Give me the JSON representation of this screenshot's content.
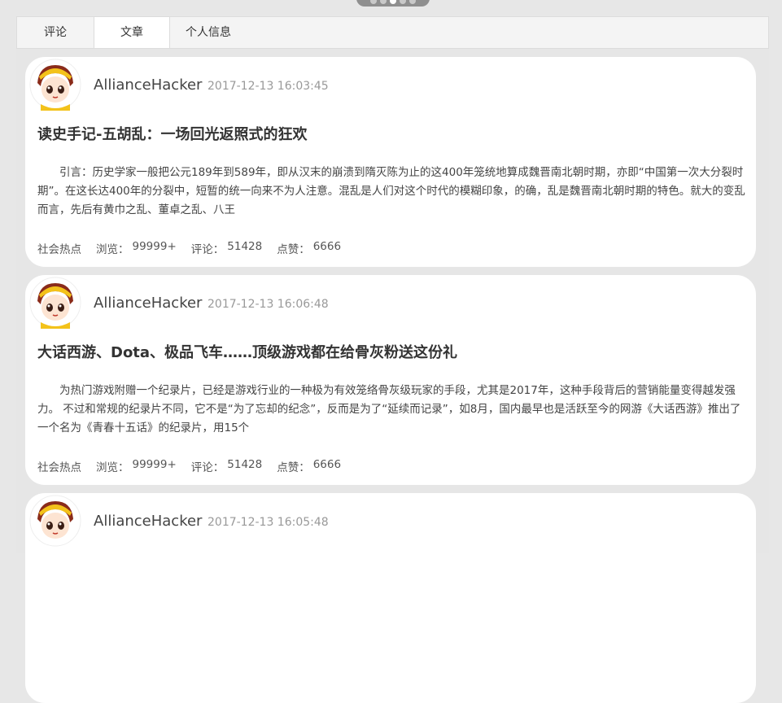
{
  "tabs": [
    {
      "label": "评论",
      "active": false
    },
    {
      "label": "文章",
      "active": true
    },
    {
      "label": "个人信息",
      "active": false
    }
  ],
  "pager": {
    "count": 5,
    "active_index": 2
  },
  "articles": [
    {
      "author": "AllianceHacker",
      "time": "2017-12-13 16:03:45",
      "title": "读史手记-五胡乱：一场回光返照式的狂欢",
      "summary": "引言：历史学家一般把公元189年到589年，即从汉末的崩溃到隋灭陈为止的这400年笼统地算成魏晋南北朝时期，亦即“中国第一次大分裂时期”。在这长达400年的分裂中，短暂的统一向来不为人注意。混乱是人们对这个时代的模糊印象，的确，乱是魏晋南北朝时期的特色。就大的变乱而言，先后有黄巾之乱、董卓之乱、八王",
      "category": "社会热点",
      "views_label": "浏览：",
      "views": "99999+",
      "comments_label": "评论：",
      "comments": "51428",
      "likes_label": "点赞：",
      "likes": "6666"
    },
    {
      "author": "AllianceHacker",
      "time": "2017-12-13 16:06:48",
      "title": "大话西游、Dota、极品飞车……顶级游戏都在给骨灰粉送这份礼",
      "summary": "为热门游戏附赠一个纪录片，已经是游戏行业的一种极为有效笼络骨灰级玩家的手段，尤其是2017年，这种手段背后的营销能量变得越发强力。 不过和常规的纪录片不同，它不是“为了忘却的纪念”，反而是为了“延续而记录”，如8月，国内最早也是活跃至今的网游《大话西游》推出了一个名为《青春十五话》的纪录片，用15个",
      "category": "社会热点",
      "views_label": "浏览：",
      "views": "99999+",
      "comments_label": "评论：",
      "comments": "51428",
      "likes_label": "点赞：",
      "likes": "6666"
    },
    {
      "author": "AllianceHacker",
      "time": "2017-12-13 16:05:48"
    }
  ]
}
